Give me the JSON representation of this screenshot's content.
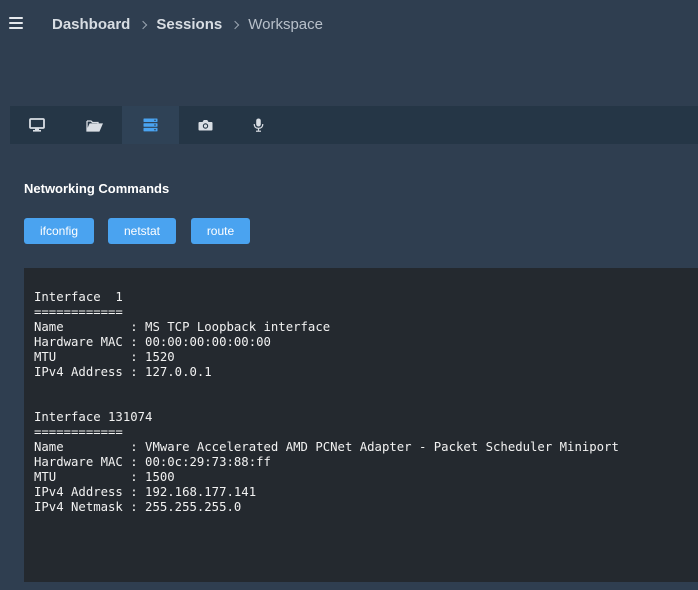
{
  "breadcrumb": {
    "items": [
      "Dashboard",
      "Sessions"
    ],
    "current": "Workspace"
  },
  "icons": {
    "menu": "hamburger-menu-icon",
    "tabs": [
      "monitor-icon",
      "folder-open-icon",
      "server-icon",
      "camera-icon",
      "microphone-icon"
    ]
  },
  "colors": {
    "accent_button": "#4aa3f0",
    "active_tab_icon": "#4aa3f0",
    "terminal_background": "#24292f"
  },
  "section": {
    "title": "Networking Commands"
  },
  "buttons": {
    "ifconfig": "ifconfig",
    "netstat": "netstat",
    "route": "route"
  },
  "terminal": {
    "output": "Interface  1\n============\nName         : MS TCP Loopback interface\nHardware MAC : 00:00:00:00:00:00\nMTU          : 1520\nIPv4 Address : 127.0.0.1\n\n\nInterface 131074\n============\nName         : VMware Accelerated AMD PCNet Adapter - Packet Scheduler Miniport\nHardware MAC : 00:0c:29:73:88:ff\nMTU          : 1500\nIPv4 Address : 192.168.177.141\nIPv4 Netmask : 255.255.255.0"
  }
}
